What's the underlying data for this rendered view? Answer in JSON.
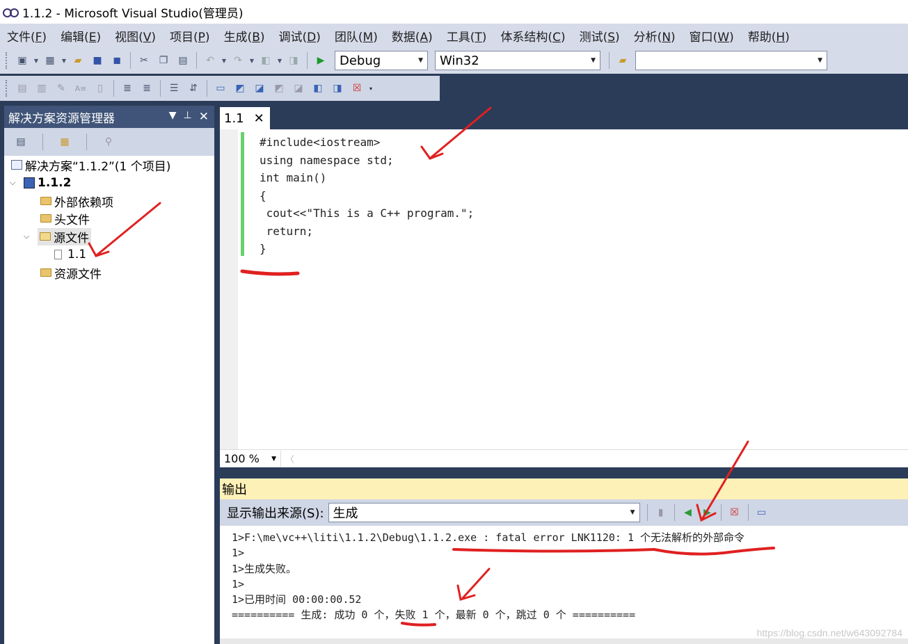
{
  "window": {
    "title": "1.1.2 - Microsoft Visual Studio(管理员)"
  },
  "menu": [
    {
      "text": "文件(",
      "key": "F",
      "end": ")"
    },
    {
      "text": "编辑(",
      "key": "E",
      "end": ")"
    },
    {
      "text": "视图(",
      "key": "V",
      "end": ")"
    },
    {
      "text": "项目(",
      "key": "P",
      "end": ")"
    },
    {
      "text": "生成(",
      "key": "B",
      "end": ")"
    },
    {
      "text": "调试(",
      "key": "D",
      "end": ")"
    },
    {
      "text": "团队(",
      "key": "M",
      "end": ")"
    },
    {
      "text": "数据(",
      "key": "A",
      "end": ")"
    },
    {
      "text": "工具(",
      "key": "T",
      "end": ")"
    },
    {
      "text": "体系结构(",
      "key": "C",
      "end": ")"
    },
    {
      "text": "测试(",
      "key": "S",
      "end": ")"
    },
    {
      "text": "分析(",
      "key": "N",
      "end": ")"
    },
    {
      "text": "窗口(",
      "key": "W",
      "end": ")"
    },
    {
      "text": "帮助(",
      "key": "H",
      "end": ")"
    }
  ],
  "toolbar": {
    "config": "Debug",
    "platform": "Win32",
    "find_value": ""
  },
  "solution_explorer": {
    "title": "解决方案资源管理器",
    "solution": "解决方案“1.1.2”(1 个项目)",
    "project": "1.1.2",
    "items": {
      "deps": "外部依赖项",
      "headers": "头文件",
      "sources": "源文件",
      "source_file": "1.1",
      "resources": "资源文件"
    }
  },
  "editor": {
    "tab": "1.1",
    "lines": [
      "#include<iostream>",
      "using namespace std;",
      "int main()",
      "{",
      " cout<<\"This is a C++ program.\";",
      " return;",
      "}"
    ],
    "zoom": "100 %"
  },
  "output": {
    "title": "输出",
    "source_label": "显示输出来源(S):",
    "source_value": "生成",
    "lines": [
      "1>F:\\me\\vc++\\liti\\1.1.2\\Debug\\1.1.2.exe : fatal error LNK1120: 1 个无法解析的外部命令",
      "1>",
      "1>生成失败。",
      "1>",
      "1>已用时间 00:00:00.52",
      "========== 生成: 成功 0 个，失败 1 个，最新 0 个，跳过 0 个 =========="
    ]
  },
  "watermark": "https://blog.csdn.net/w643092784",
  "colors": {
    "accent": "#2b3c59",
    "annotation": "#e02020",
    "output_header": "#fdf1b8"
  }
}
